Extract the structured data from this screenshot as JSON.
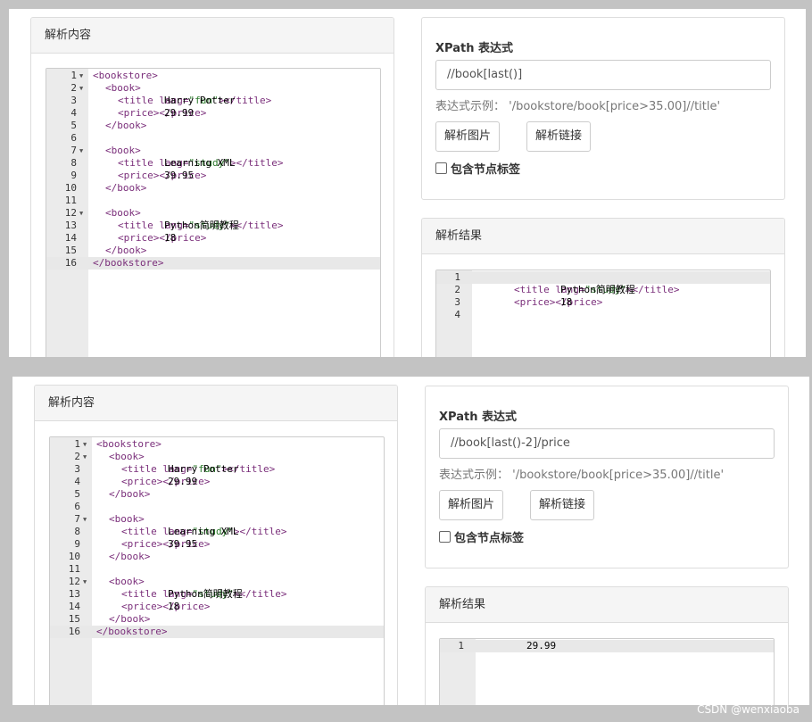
{
  "snapshots": [
    {
      "left_panel_title": "解析内容",
      "xpath_title": "XPath 表达式",
      "xpath_value": "//book[last()]",
      "hint": "表达式示例：  '/bookstore/book[price>35.00]//title'",
      "btn_image": "解析图片",
      "btn_link": "解析链接",
      "checkbox_label": "包含节点标签",
      "result_title": "解析结果"
    },
    {
      "left_panel_title": "解析内容",
      "xpath_title": "XPath 表达式",
      "xpath_value": "//book[last()-2]/price",
      "hint": "表达式示例：  '/bookstore/book[price>35.00]//title'",
      "btn_image": "解析图片",
      "btn_link": "解析链接",
      "checkbox_label": "包含节点标签",
      "result_title": "解析结果"
    }
  ],
  "source_code": [
    {
      "n": "1",
      "fold": true,
      "indent": 0,
      "parts": [
        [
          "tag",
          "<bookstore>"
        ]
      ]
    },
    {
      "n": "2",
      "fold": true,
      "indent": 1,
      "parts": [
        [
          "tag",
          "<book>"
        ]
      ]
    },
    {
      "n": "3",
      "fold": false,
      "indent": 2,
      "parts": [
        [
          "tag",
          "<title "
        ],
        [
          "attr",
          "lang="
        ],
        [
          "str",
          "\"fun\""
        ],
        [
          "tag",
          ">"
        ],
        [
          "txt",
          "Harry Potter"
        ],
        [
          "tag",
          "</title>"
        ]
      ]
    },
    {
      "n": "4",
      "fold": false,
      "indent": 2,
      "parts": [
        [
          "tag",
          "<price>"
        ],
        [
          "txt",
          "29.99"
        ],
        [
          "tag",
          "</price>"
        ]
      ]
    },
    {
      "n": "5",
      "fold": false,
      "indent": 1,
      "parts": [
        [
          "tag",
          "</book>"
        ]
      ]
    },
    {
      "n": "6",
      "fold": false,
      "indent": 0,
      "parts": []
    },
    {
      "n": "7",
      "fold": true,
      "indent": 1,
      "parts": [
        [
          "tag",
          "<book>"
        ]
      ]
    },
    {
      "n": "8",
      "fold": false,
      "indent": 2,
      "parts": [
        [
          "tag",
          "<title "
        ],
        [
          "attr",
          "lang="
        ],
        [
          "str",
          "\"study\""
        ],
        [
          "tag",
          ">"
        ],
        [
          "txt",
          "Learning XML"
        ],
        [
          "tag",
          "</title>"
        ]
      ]
    },
    {
      "n": "9",
      "fold": false,
      "indent": 2,
      "parts": [
        [
          "tag",
          "<price>"
        ],
        [
          "txt",
          "39.95"
        ],
        [
          "tag",
          "</price>"
        ]
      ]
    },
    {
      "n": "10",
      "fold": false,
      "indent": 1,
      "parts": [
        [
          "tag",
          "</book>"
        ]
      ]
    },
    {
      "n": "11",
      "fold": false,
      "indent": 0,
      "parts": []
    },
    {
      "n": "12",
      "fold": true,
      "indent": 1,
      "parts": [
        [
          "tag",
          "<book>"
        ]
      ]
    },
    {
      "n": "13",
      "fold": false,
      "indent": 2,
      "parts": [
        [
          "tag",
          "<title "
        ],
        [
          "attr",
          "lang="
        ],
        [
          "str",
          "\"study\""
        ],
        [
          "tag",
          ">"
        ],
        [
          "txt",
          "Python简明教程"
        ],
        [
          "tag",
          "</title>"
        ]
      ]
    },
    {
      "n": "14",
      "fold": false,
      "indent": 2,
      "parts": [
        [
          "tag",
          "<price>"
        ],
        [
          "txt",
          "18"
        ],
        [
          "tag",
          "</price>"
        ]
      ]
    },
    {
      "n": "15",
      "fold": false,
      "indent": 1,
      "parts": [
        [
          "tag",
          "</book>"
        ]
      ]
    },
    {
      "n": "16",
      "fold": false,
      "indent": 0,
      "active": true,
      "parts": [
        [
          "tag",
          "</bookstore>"
        ]
      ]
    }
  ],
  "results": [
    [
      {
        "n": "1",
        "indent": 0,
        "active": true,
        "parts": []
      },
      {
        "n": "2",
        "indent": 3,
        "parts": [
          [
            "tag",
            "<title "
          ],
          [
            "attr",
            "lang="
          ],
          [
            "str",
            "\"study\""
          ],
          [
            "tag",
            ">"
          ],
          [
            "txt",
            "Python简明教程"
          ],
          [
            "tag",
            "</title>"
          ]
        ]
      },
      {
        "n": "3",
        "indent": 3,
        "parts": [
          [
            "tag",
            "<price>"
          ],
          [
            "txt",
            "18"
          ],
          [
            "tag",
            "</price>"
          ]
        ]
      },
      {
        "n": "4",
        "indent": 0,
        "parts": []
      }
    ],
    [
      {
        "n": "1",
        "indent": 0,
        "active": true,
        "parts": [
          [
            "txt",
            "29.99"
          ]
        ]
      }
    ]
  ],
  "watermark": "CSDN @wenxiaoba"
}
